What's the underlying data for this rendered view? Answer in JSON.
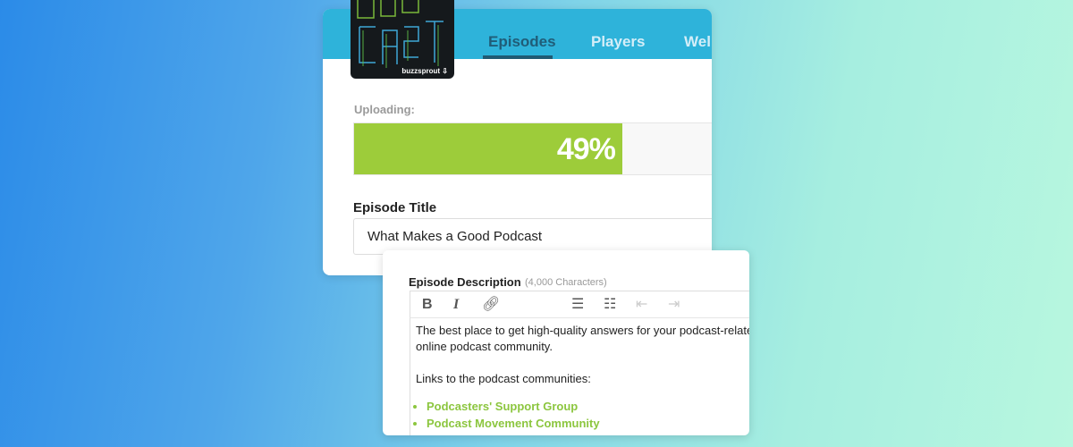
{
  "header": {
    "podcast_art": {
      "title_art": "BUZZCAST",
      "brand": "buzzsprout"
    },
    "tabs": [
      {
        "label": "Episodes",
        "active": true
      },
      {
        "label": "Players",
        "active": false
      },
      {
        "label": "Wel",
        "active": false
      }
    ]
  },
  "upload": {
    "label": "Uploading:",
    "progress_percent": 49,
    "progress_text": "49%",
    "fill_color": "#9dcc3a"
  },
  "episode_title": {
    "label": "Episode Title",
    "value": "What Makes a Good Podcast"
  },
  "description": {
    "label": "Episode Description",
    "limit": "(4,000 Characters)",
    "toolbar": [
      "bold-icon",
      "italic-icon",
      "link-icon",
      "bullet-list-icon",
      "numbered-list-icon",
      "outdent-icon",
      "indent-icon"
    ],
    "paragraphs": [
      "The best place to get high-quality answers for your podcast-related",
      "online podcast community.",
      "Links to the podcast communities:"
    ],
    "links": [
      "Podcasters' Support Group",
      "Podcast Movement Community"
    ],
    "link_color": "#8cc63f"
  },
  "colors": {
    "header_band": "#2eb3da",
    "active_tab": "#205d78"
  }
}
